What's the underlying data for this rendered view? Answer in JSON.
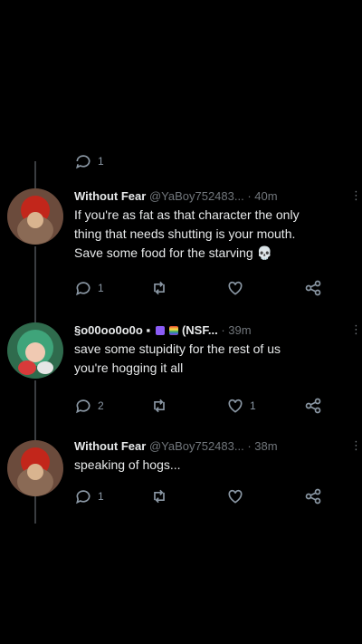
{
  "tweets": [
    {
      "name": "Without Fear",
      "handle": "@YaBoy752483...",
      "dot": "·",
      "time": "40m",
      "body_lines": [
        "If you're as fat as that character the only",
        "thing that needs shutting is your mouth.",
        "Save some food for the starving"
      ],
      "emoji": "💀",
      "reply_count": "1",
      "retweet_count": "",
      "like_count": ""
    },
    {
      "name": "§o00oo0o0o",
      "name_suffix": "(NSF...",
      "dot": "·",
      "time": "39m",
      "body_lines": [
        "save some stupidity for the rest of us",
        "you're hogging it all"
      ],
      "reply_count": "2",
      "retweet_count": "",
      "like_count": "1"
    },
    {
      "name": "Without Fear",
      "handle": "@YaBoy752483...",
      "dot": "·",
      "time": "38m",
      "body_lines": [
        "speaking of hogs..."
      ],
      "reply_count": "1",
      "retweet_count": "",
      "like_count": ""
    }
  ],
  "top_partial_row": {
    "reply_count": "1"
  },
  "colors": {
    "background": "#000000",
    "text": "#e7e9ea",
    "muted": "#71767b",
    "thread_line": "#3a3d41"
  },
  "icons": [
    "reply-icon",
    "retweet-icon",
    "like-icon",
    "share-icon",
    "more-icon",
    "skull-emoji",
    "pin-icon",
    "purple-badge-icon",
    "flag-icon"
  ]
}
